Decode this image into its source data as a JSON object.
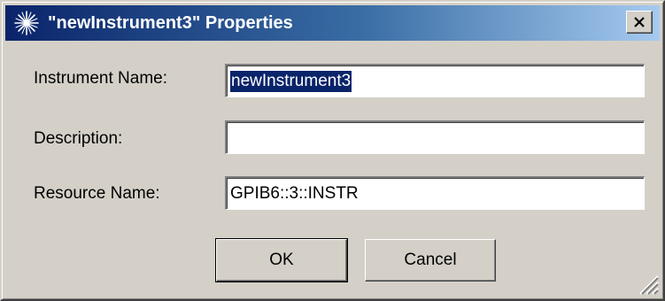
{
  "window": {
    "title": "\"newInstrument3\" Properties",
    "close_glyph": "X"
  },
  "form": {
    "instrument_name_label": "Instrument Name:",
    "instrument_name_value": "newInstrument3",
    "description_label": "Description:",
    "description_value": "",
    "resource_name_label": "Resource Name:",
    "resource_name_value": "GPIB6::3::INSTR"
  },
  "buttons": {
    "ok_label": "OK",
    "cancel_label": "Cancel"
  },
  "icons": {
    "app": "agilent-spark-icon",
    "close": "close-icon",
    "resize": "resize-grip-icon"
  },
  "colors": {
    "titlebar_start": "#0a246a",
    "titlebar_end": "#a6caf0",
    "face": "#d4d0c8",
    "selection": "#0a246a"
  }
}
